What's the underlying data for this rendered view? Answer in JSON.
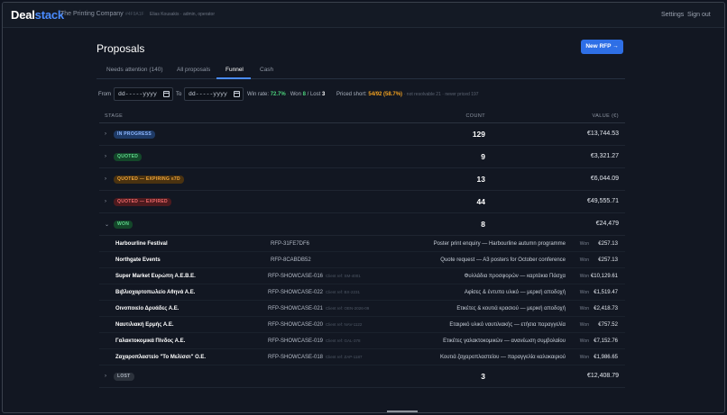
{
  "header": {
    "logo_part1": "Deal",
    "logo_part2": "stack",
    "company": "The Printing Company",
    "tenant": "#4F9A1F",
    "user": "Elias Kousakis · admin, operator",
    "settings": "Settings",
    "signout": "Sign out"
  },
  "page": {
    "title": "Proposals",
    "new_button": "New RFP →"
  },
  "tabs": [
    {
      "label": "Needs attention (140)",
      "active": false
    },
    {
      "label": "All proposals",
      "active": false
    },
    {
      "label": "Funnel",
      "active": true
    },
    {
      "label": "Cash",
      "active": false
    }
  ],
  "filters": {
    "from_label": "From",
    "to_label": "To",
    "from_placeholder": "dd-----yyyy",
    "to_placeholder": "dd-----yyyy",
    "win_rate_label": "Win rate:",
    "win_rate": "72.7%",
    "dot": "·",
    "won_label": "Won",
    "won": "8",
    "lost_label": "/ Lost",
    "lost": "3",
    "priced_label": "Priced short:",
    "priced": "54/92 (58.7%)",
    "priced_note": "· not resolvable 21 · never priced 197"
  },
  "table": {
    "col_stage": "STAGE",
    "col_count": "COUNT",
    "col_value": "VALUE (€)",
    "stages": [
      {
        "label": "IN PROGRESS",
        "count": "129",
        "value": "€13,744.53",
        "bg": "#1e3a66",
        "fg": "#8fb8ff"
      },
      {
        "label": "QUOTED",
        "count": "9",
        "value": "€3,321.27",
        "bg": "#14472a",
        "fg": "#5fd68c"
      },
      {
        "label": "QUOTED — EXPIRING ≤7D",
        "count": "13",
        "value": "€6,044.09",
        "bg": "#4a3210",
        "fg": "#f0a53a"
      },
      {
        "label": "QUOTED — EXPIRED",
        "count": "44",
        "value": "€49,555.71",
        "bg": "#4d1a1e",
        "fg": "#f06a6a"
      },
      {
        "label": "WON",
        "count": "8",
        "value": "€24,479",
        "bg": "#14472a",
        "fg": "#5fd68c"
      }
    ],
    "won_rows": [
      {
        "name": "Harbourline Festival",
        "ref": "RFP-31FE7DF6",
        "client_ref": "",
        "title": "Poster print enquiry — Harbourline autumn programme",
        "status": "Won",
        "value": "€257.13"
      },
      {
        "name": "Northgate Events",
        "ref": "RFP-8CABDB52",
        "client_ref": "",
        "title": "Quote request — A3 posters for October conference",
        "status": "Won",
        "value": "€257.13"
      },
      {
        "name": "Super Market Ευρώπη Α.Ε.Β.Ε.",
        "ref": "RFP-SHOWCASE-016",
        "client_ref": "Client ref: SM-4001",
        "title": "Φυλλάδια προσφορών — καρτάκια Πάσχα",
        "status": "Won",
        "value": "€10,129.61"
      },
      {
        "name": "Βιβλιοχαρτοπωλείο Αθηνά Α.Ε.",
        "ref": "RFP-SHOWCASE-022",
        "client_ref": "Client ref: BX-2231",
        "title": "Αφίσες & έντυπο υλικό — μερική αποδοχή",
        "status": "Won",
        "value": "€1,519.47"
      },
      {
        "name": "Οινοποιείο Δρυάδες Α.Ε.",
        "ref": "RFP-SHOWCASE-021",
        "client_ref": "Client ref: OEN-2026-09",
        "title": "Ετικέτες & κουτιά κρασιού — μερική αποδοχή",
        "status": "Won",
        "value": "€2,418.73"
      },
      {
        "name": "Ναυτιλιακή Ερμής Α.Ε.",
        "ref": "RFP-SHOWCASE-020",
        "client_ref": "Client ref: NAV-1122",
        "title": "Εταιρικό υλικό ναυτιλιακής — ετήσια παραγγελία",
        "status": "Won",
        "value": "€757.52"
      },
      {
        "name": "Γαλακτοκομικά Πίνδος Α.Ε.",
        "ref": "RFP-SHOWCASE-019",
        "client_ref": "Client ref: GAL-378",
        "title": "Ετικέτες γαλακτοκομικών — ανανέωση συμβολαίου",
        "status": "Won",
        "value": "€7,152.76"
      },
      {
        "name": "Ζαχαροπλαστείο \"Το Μελίσσι\" Ο.Ε.",
        "ref": "RFP-SHOWCASE-018",
        "client_ref": "Client ref: ZAP-1187",
        "title": "Κουτιά ζαχαροπλαστείου — παραγγελία καλοκαιριού",
        "status": "Won",
        "value": "€1,986.65"
      }
    ],
    "lost": {
      "label": "LOST",
      "count": "3",
      "value": "€12,408.79",
      "bg": "#2c323c",
      "fg": "#a7afbb"
    }
  }
}
